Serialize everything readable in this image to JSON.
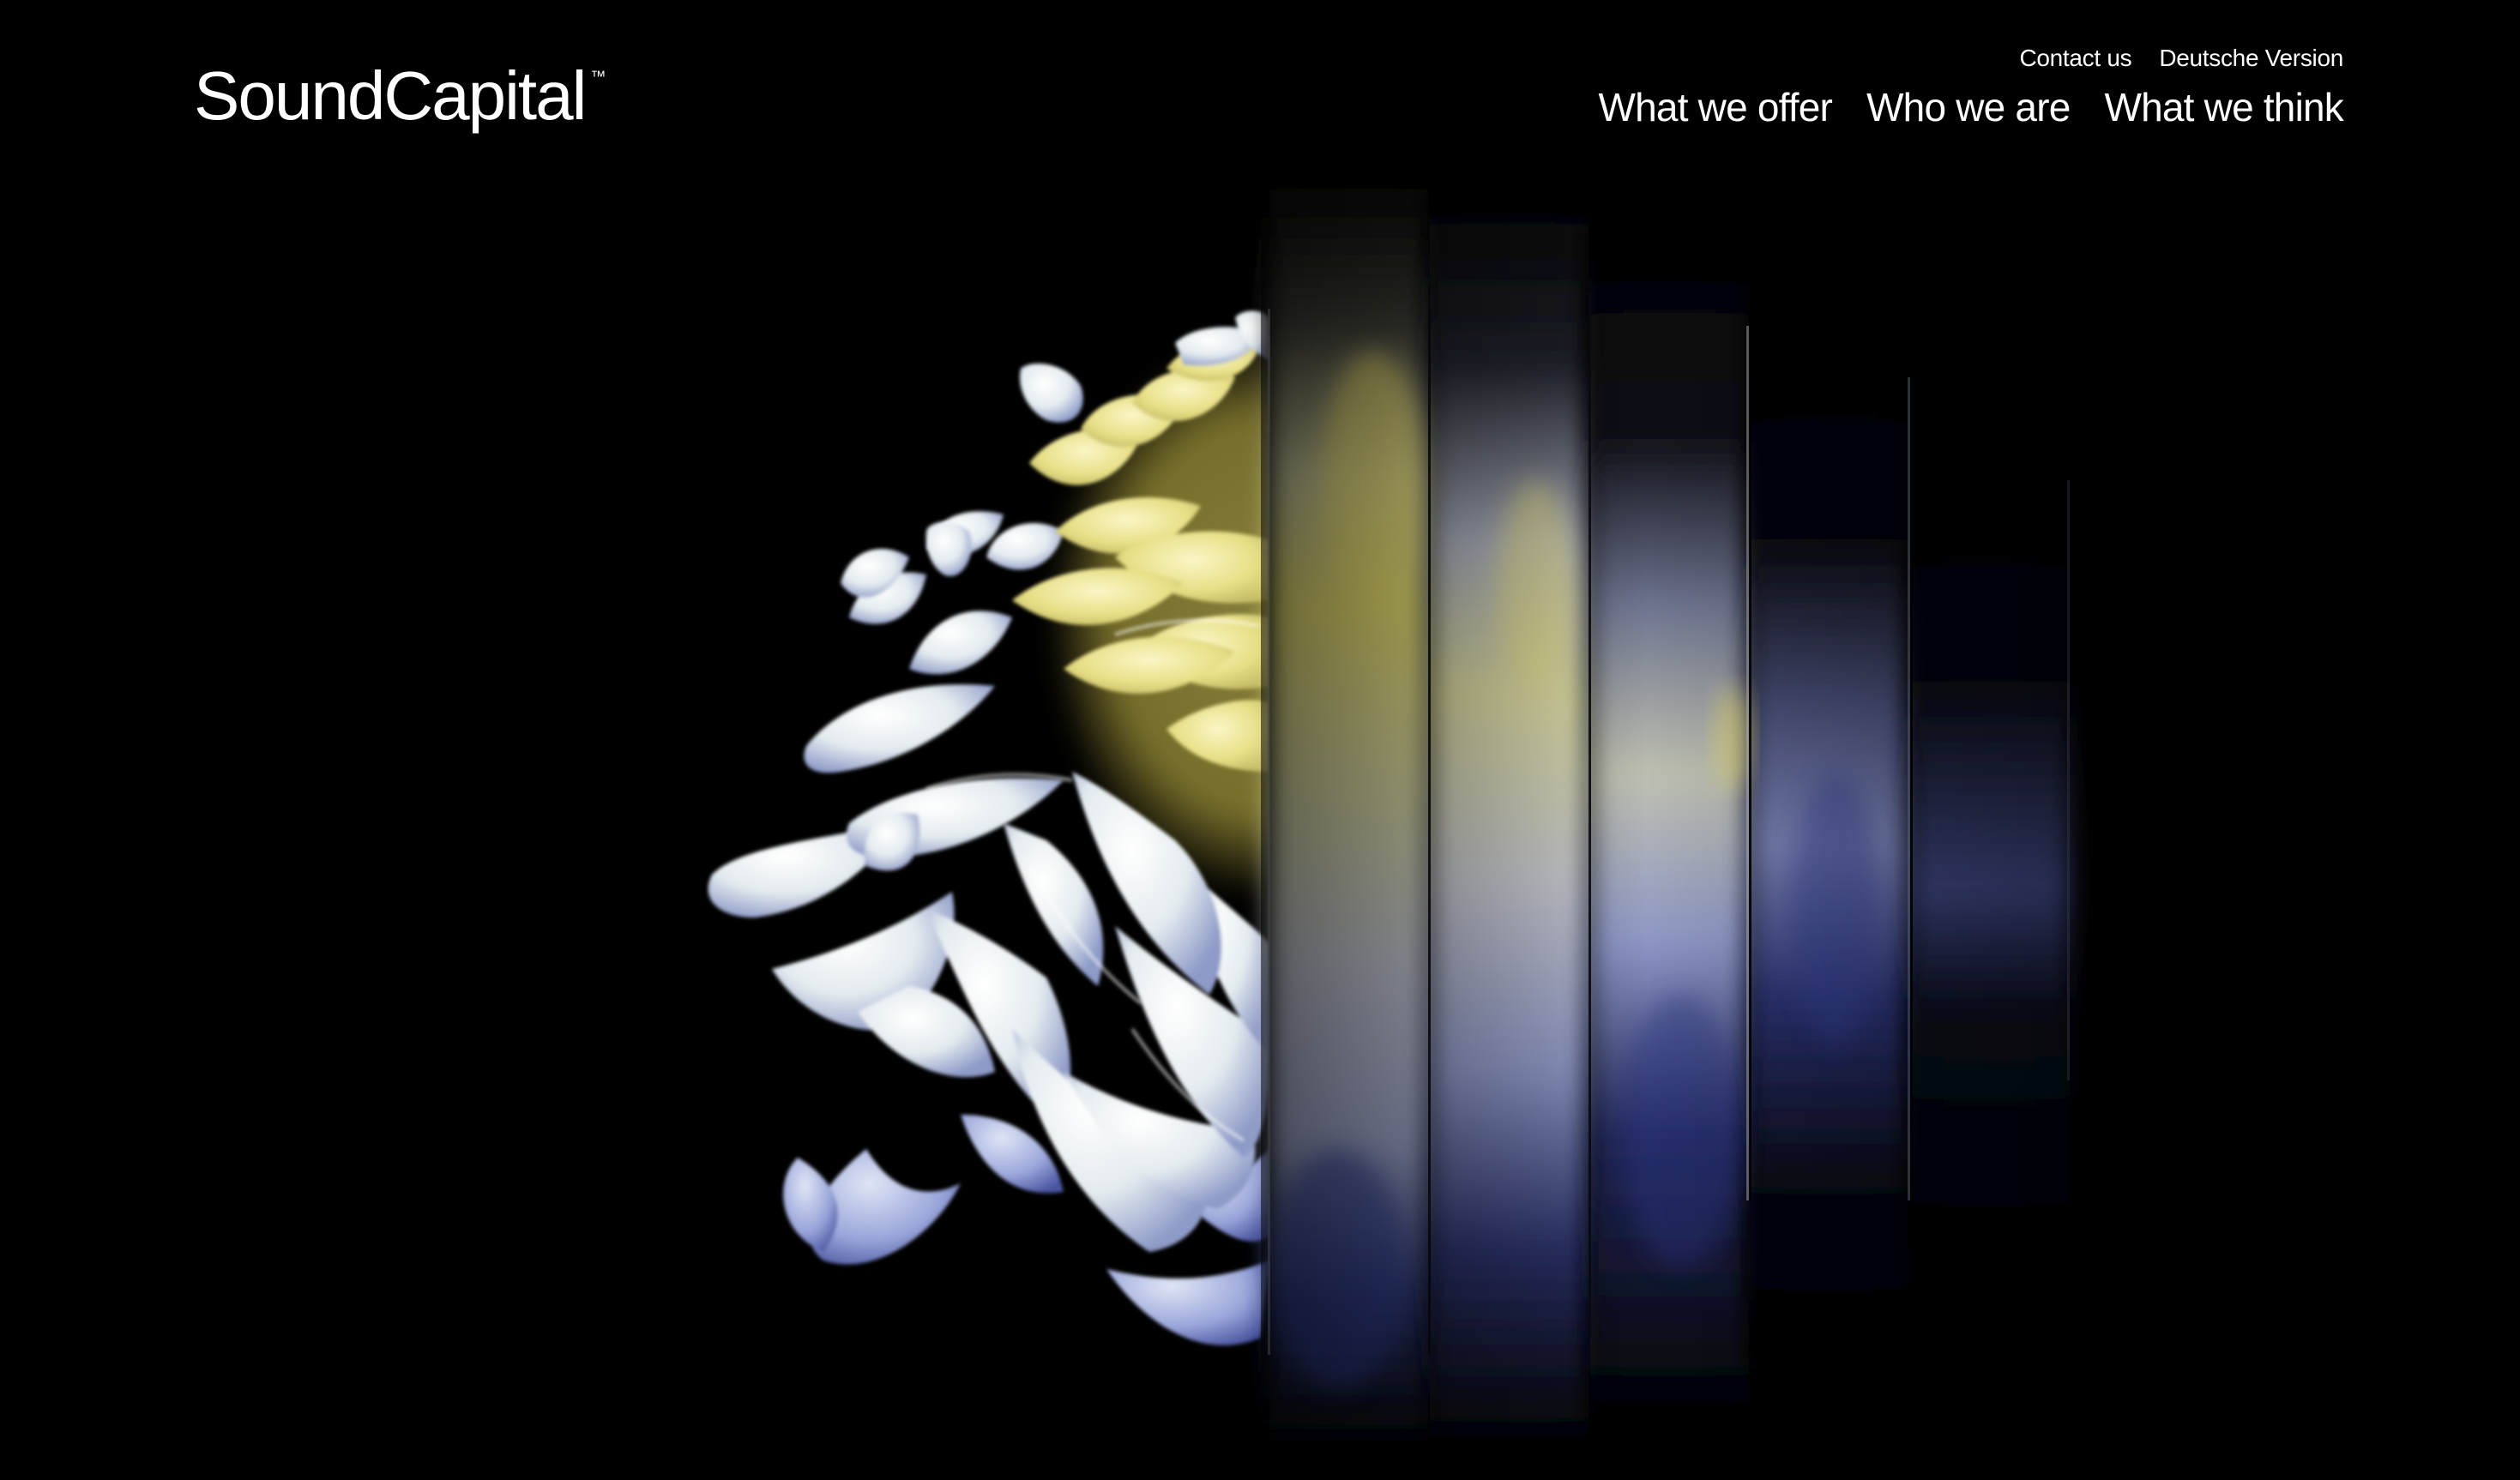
{
  "brand": {
    "name": "SoundCapital",
    "trademark": "™"
  },
  "utility_nav": {
    "contact": "Contact us",
    "language": "Deutsche Version"
  },
  "main_nav": {
    "items": [
      {
        "label": "What we offer"
      },
      {
        "label": "Who we are"
      },
      {
        "label": "What we think"
      }
    ]
  },
  "colors": {
    "background": "#000000",
    "text": "#ffffff",
    "petal_white": "#eef3f5",
    "petal_yellow": "#ece58a",
    "petal_blue": "#8793cf"
  },
  "icons": {
    "hero": "chrysanthemum-flower-with-glass-refraction"
  }
}
